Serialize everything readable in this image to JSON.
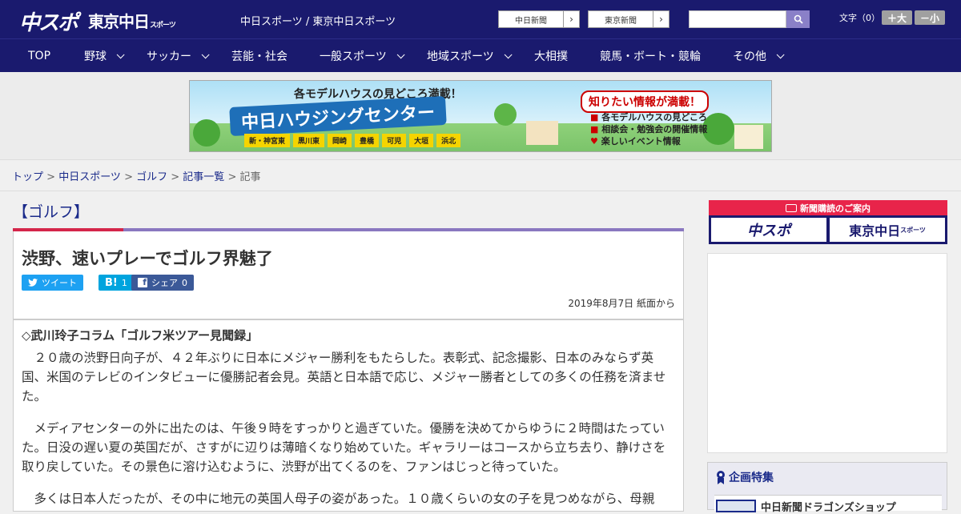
{
  "header": {
    "logo_chuspo": "中スポ",
    "logo_tokyo": "東京中日",
    "logo_tokyo_suffix": "スポーツ",
    "site_links": "中日スポーツ / 東京中日スポーツ",
    "ext_link_1": "中日新聞",
    "ext_link_2": "東京新聞",
    "search": {
      "placeholder": ""
    },
    "font_size_label": "文字（0）",
    "font_larger": "＋大",
    "font_smaller": "－小"
  },
  "nav": {
    "items": [
      {
        "label": "TOP",
        "dropdown": false
      },
      {
        "label": "野球",
        "dropdown": true
      },
      {
        "label": "サッカー",
        "dropdown": true
      },
      {
        "label": "芸能・社会",
        "dropdown": false
      },
      {
        "label": "一般スポーツ",
        "dropdown": true
      },
      {
        "label": "地域スポーツ",
        "dropdown": true
      },
      {
        "label": "大相撲",
        "dropdown": false
      },
      {
        "label": "競馬・ボート・競輪",
        "dropdown": false
      },
      {
        "label": "その他",
        "dropdown": true
      }
    ]
  },
  "ad": {
    "top_text": "各モデルハウスの見どころ満載！",
    "main_text": "中日ハウジングセンター",
    "towns": [
      "新・神宮東",
      "黒川東",
      "岡崎",
      "豊橋",
      "可児",
      "大垣",
      "浜北"
    ],
    "right_title": "知りたい情報が満載！",
    "right_items": [
      "各モデルハウスの見どころ",
      "相談会・勉強会の開催情報",
      "楽しいイベント情報"
    ]
  },
  "breadcrumb": {
    "items": [
      "トップ",
      "中日スポーツ",
      "ゴルフ",
      "記事一覧"
    ],
    "current": "記事",
    "sep": " > "
  },
  "article": {
    "category": "【ゴルフ】",
    "title": "渋野、速いプレーでゴルフ界魅了",
    "share": {
      "tweet": "ツイート",
      "hatena_count": "1",
      "facebook": "シェア",
      "facebook_count": "0"
    },
    "date": "2019年8月7日 紙面から",
    "subtitle": "◇武川玲子コラム「ゴルフ米ツアー見聞録」",
    "paragraphs": [
      "２０歳の渋野日向子が、４２年ぶりに日本にメジャー勝利をもたらした。表彰式、記念撮影、日本のみならず英国、米国のテレビのインタビューに優勝記者会見。英語と日本語で応じ、メジャー勝者としての多くの任務を済ませた。",
      "メディアセンターの外に出たのは、午後９時をすっかりと過ぎていた。優勝を決めてからゆうに２時間はたっていた。日没の遅い夏の英国だが、さすがに辺りは薄暗くなり始めていた。ギャラリーはコースから立ち去り、静けさを取り戻していた。その景色に溶け込むように、渋野が出てくるのを、ファンはじっと待っていた。",
      "多くは日本人だったが、その中に地元の英国人母子の姿があった。１０歳くらいの女の子を見つめながら、母親"
    ]
  },
  "sidebar": {
    "subscribe_head": "新聞購読のご案内",
    "subscribe_1": "中スポ",
    "subscribe_2": "東京中日",
    "subscribe_2_suffix": "スポーツ",
    "feature_title": "企画特集",
    "feature_item": "中日新聞ドラゴンズショップ"
  },
  "colors": {
    "brand_navy": "#1a1a6e",
    "accent_red": "#d4264a",
    "accent_purple": "#8a78c0",
    "share_twitter": "#1da1f2",
    "share_hatena": "#00a4de",
    "share_facebook": "#3b5998"
  }
}
